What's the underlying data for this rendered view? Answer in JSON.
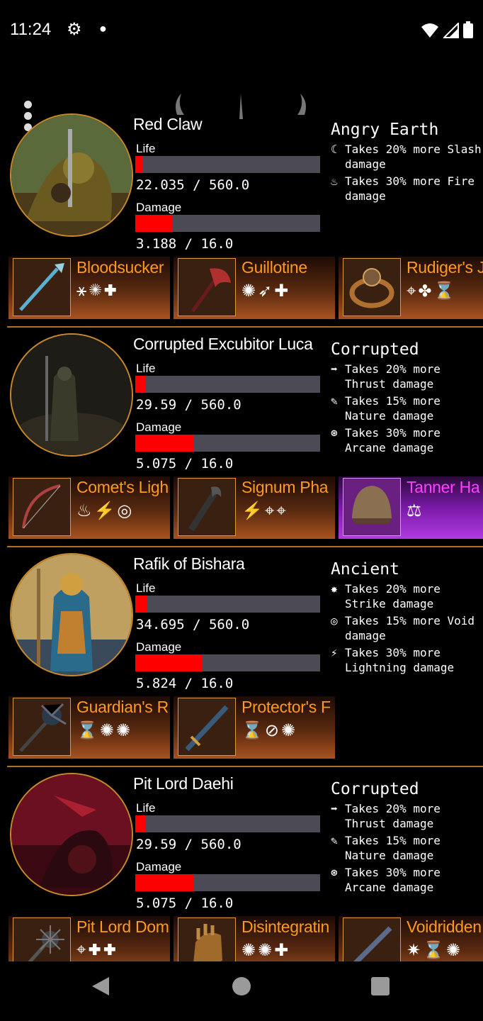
{
  "status_bar": {
    "time": "11:24",
    "icons": [
      "gear-icon",
      "notification-dot",
      "wifi-icon",
      "signal-icon",
      "battery-icon"
    ]
  },
  "colors": {
    "bar_fill": "#ff0000",
    "bar_track": "#4b4a55",
    "item_name": "#ff9a1a",
    "separator": "#b0701f",
    "rare_item": "#b03ae0"
  },
  "bosses": [
    {
      "name": "Red Claw",
      "life_label": "Life",
      "life_value": "22.035 / 560.0",
      "life_fraction": 0.039,
      "damage_label": "Damage",
      "damage_value": "3.188 / 16.0",
      "damage_fraction": 0.199,
      "affix": {
        "title": "Angry Earth",
        "effects": [
          {
            "icon": "slash-icon",
            "text": "Takes 20% more Slash damage"
          },
          {
            "icon": "fire-icon",
            "text": "Takes 30% more Fire damage"
          }
        ]
      },
      "items": [
        {
          "name": "Bloodsucker",
          "icon": "spear-icon",
          "symbols": "⚹✺✚"
        },
        {
          "name": "Guillotine",
          "icon": "axe-icon",
          "symbols": "✺➶✚"
        },
        {
          "name": "Rudiger's J",
          "icon": "ring-icon",
          "symbols": "⌖✤⌛"
        }
      ]
    },
    {
      "name": "Corrupted Excubitor Luca",
      "life_label": "Life",
      "life_value": "29.59 / 560.0",
      "life_fraction": 0.053,
      "damage_label": "Damage",
      "damage_value": "5.075 / 16.0",
      "damage_fraction": 0.317,
      "affix": {
        "title": "Corrupted",
        "effects": [
          {
            "icon": "thrust-icon",
            "text": "Takes 20% more Thrust damage"
          },
          {
            "icon": "nature-icon",
            "text": "Takes 15% more Nature damage"
          },
          {
            "icon": "arcane-icon",
            "text": "Takes 30% more Arcane damage"
          }
        ]
      },
      "items": [
        {
          "name": "Comet's Ligh",
          "icon": "bow-icon",
          "symbols": "♨⚡◎"
        },
        {
          "name": "Signum Pha",
          "icon": "claw-icon",
          "symbols": "⚡⌖⌖"
        },
        {
          "name": "Tanner Ha",
          "icon": "helmet-icon",
          "symbols": "⚖",
          "rarity": "rare"
        }
      ]
    },
    {
      "name": "Rafik of Bishara",
      "life_label": "Life",
      "life_value": "34.695 / 560.0",
      "life_fraction": 0.062,
      "damage_label": "Damage",
      "damage_value": "5.824 / 16.0",
      "damage_fraction": 0.364,
      "affix": {
        "title": "Ancient",
        "effects": [
          {
            "icon": "strike-icon",
            "text": "Takes 20% more Strike damage"
          },
          {
            "icon": "void-icon",
            "text": "Takes 15% more Void damage"
          },
          {
            "icon": "lightning-icon",
            "text": "Takes 30% more Lightning damage"
          }
        ]
      },
      "items": [
        {
          "name": "Guardian's R",
          "icon": "mace-icon",
          "symbols": "⌛✺✺"
        },
        {
          "name": "Protector's F",
          "icon": "sword-icon",
          "symbols": "⌛⊘✺"
        }
      ]
    },
    {
      "name": "Pit Lord Daehi",
      "life_label": "Life",
      "life_value": "29.59 / 560.0",
      "life_fraction": 0.053,
      "damage_label": "Damage",
      "damage_value": "5.075 / 16.0",
      "damage_fraction": 0.317,
      "affix": {
        "title": "Corrupted",
        "effects": [
          {
            "icon": "thrust-icon",
            "text": "Takes 20% more Thrust damage"
          },
          {
            "icon": "nature-icon",
            "text": "Takes 15% more Nature damage"
          },
          {
            "icon": "arcane-icon",
            "text": "Takes 30% more Arcane damage"
          }
        ]
      },
      "items": [
        {
          "name": "Pit Lord Dom",
          "icon": "morningstar-icon",
          "symbols": "⌖✚✚"
        },
        {
          "name": "Disintegratin",
          "icon": "gauntlet-icon",
          "symbols": "✺✺✚"
        },
        {
          "name": "Voidridden",
          "icon": "rifle-icon",
          "symbols": "✷⌛✺"
        }
      ]
    }
  ],
  "nav": {
    "icons": [
      "back-icon",
      "home-icon",
      "recents-icon"
    ]
  }
}
